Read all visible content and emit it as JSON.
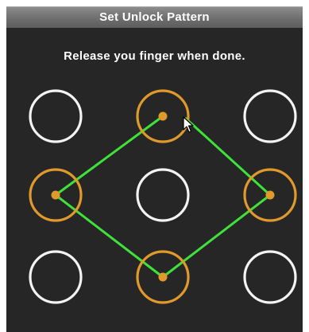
{
  "dialog": {
    "title": "Set Unlock Pattern",
    "instruction": "Release you finger when done."
  },
  "pattern": {
    "selected_dots": [
      2,
      6,
      8,
      4,
      2
    ],
    "colors": {
      "ring_idle": "#f3f3f3",
      "ring_active": "#e09a2c",
      "line": "#3fe23a",
      "panel_bg": "#262626",
      "title_bg": "#6e6e6e"
    }
  },
  "icons": {
    "cursor": "mouse-pointer-icon"
  }
}
